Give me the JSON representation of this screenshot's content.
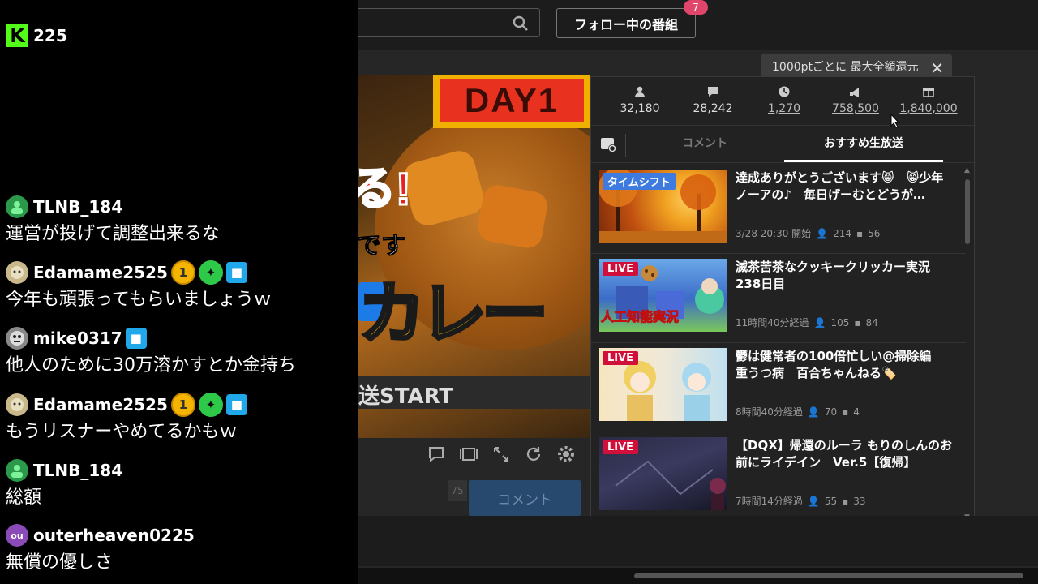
{
  "overlay": {
    "viewer_count": "225",
    "logo_letter": "K",
    "logo_color": "#53fc18"
  },
  "chat": [
    {
      "username": "TLNB_184",
      "avatar_color": "#2a9a4a",
      "avatar_text": "",
      "badges": [],
      "message": "運営が投げて調整出来るな"
    },
    {
      "username": "Edamame2525",
      "avatar_color": "#c9b88a",
      "avatar_text": "",
      "badges": [
        "one-badge",
        "star-badge",
        "cube-badge"
      ],
      "message": "今年も頑張ってもらいましょうｗ"
    },
    {
      "username": "mike0317",
      "avatar_color": "#888888",
      "avatar_text": "",
      "badges": [
        "cube-badge"
      ],
      "message": "他人のために30万溶かすとか金持ち"
    },
    {
      "username": "Edamame2525",
      "avatar_color": "#c9b88a",
      "avatar_text": "",
      "badges": [
        "one-badge",
        "star-badge",
        "cube-badge"
      ],
      "message": "もうリスナーやめてるかもｗ"
    },
    {
      "username": "TLNB_184",
      "avatar_color": "#2a9a4a",
      "avatar_text": "",
      "badges": [],
      "message": "総額"
    },
    {
      "username": "outerheaven0225",
      "avatar_color": "#8a4ab8",
      "avatar_text": "ou",
      "badges": [],
      "message": "無償の優しさ"
    }
  ],
  "badge_glyphs": {
    "one": "1",
    "star": "✦",
    "cube": "■"
  },
  "header": {
    "follow_button_label": "フォロー中の番組",
    "follow_count": "7"
  },
  "tooltip": {
    "text": "1000ptごとに 最大全額還元",
    "close_glyph": "✕"
  },
  "video": {
    "day_label": "DAY1",
    "exclaim": "る!",
    "desu": "です",
    "curry": "カレー",
    "start_text": "送START"
  },
  "comment_box": {
    "char_count": "75",
    "submit_label": "コメント"
  },
  "stats": [
    {
      "icon": "person-icon",
      "value": "32,180",
      "underlined": false
    },
    {
      "icon": "comment-icon",
      "value": "28,242",
      "underlined": false
    },
    {
      "icon": "clock-icon",
      "value": "1,270",
      "underlined": true
    },
    {
      "icon": "ad-icon",
      "value": "758,500",
      "underlined": true
    },
    {
      "icon": "gift-icon",
      "value": "1,840,000",
      "underlined": true
    }
  ],
  "tabs": {
    "comment": "コメント",
    "recommended": "おすすめ生放送"
  },
  "recommendations": [
    {
      "badge": "タイムシフト",
      "badge_type": "timeshift",
      "title": "達成ありがとうございます😸　😸少年ノーアの♪　毎日げーむとどうが…",
      "time": "3/28 20:30 開始",
      "viewers": "214",
      "comments": "56",
      "thumb_colors": [
        "#f0a020",
        "#c05010",
        "#7a2a08"
      ]
    },
    {
      "badge": "LIVE",
      "badge_type": "live",
      "title": "滅茶苦茶なクッキークリッカー実況 238日目",
      "time": "11時間40分経過",
      "viewers": "105",
      "comments": "84",
      "thumb_colors": [
        "#6aa8e8",
        "#3c6cc8",
        "#7ac85a"
      ],
      "thumb_caption": "人工知能実況"
    },
    {
      "badge": "LIVE",
      "badge_type": "live",
      "title": "鬱は健常者の100倍忙しい@掃除編　重うつ病　百合ちゃんねる🏷️",
      "time": "8時間40分経過",
      "viewers": "70",
      "comments": "4",
      "thumb_colors": [
        "#f6e6c0",
        "#e8c060",
        "#9ad0e8"
      ]
    },
    {
      "badge": "LIVE",
      "badge_type": "live",
      "title": "【DQX】帰還のルーラ もりのしんのお前にライデイン　Ver.5【復帰】",
      "time": "7時間14分経過",
      "viewers": "55",
      "comments": "33",
      "thumb_colors": [
        "#2a2a44",
        "#3a3a60",
        "#161626"
      ]
    }
  ]
}
